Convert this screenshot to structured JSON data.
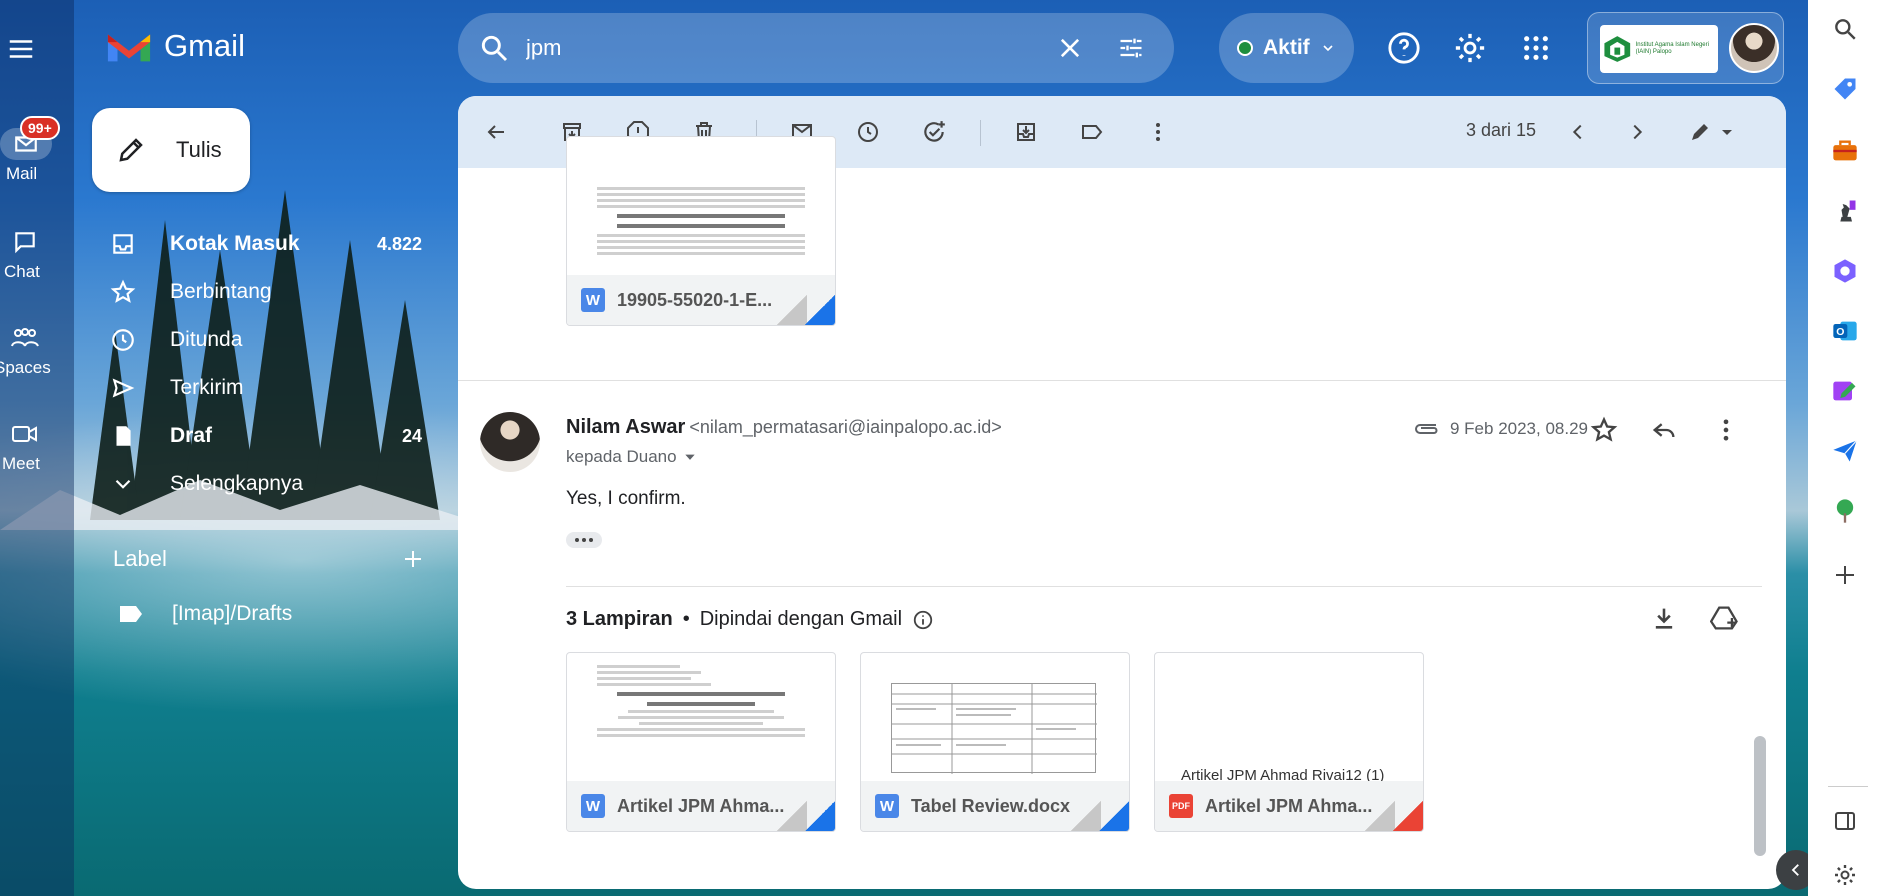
{
  "app": {
    "name": "Gmail"
  },
  "rail": {
    "mail_label": "Mail",
    "mail_badge": "99+",
    "chat_label": "Chat",
    "spaces_label": "Spaces",
    "meet_label": "Meet"
  },
  "compose": {
    "label": "Tulis"
  },
  "nav": {
    "inbox": {
      "label": "Kotak Masuk",
      "count": "4.822"
    },
    "starred": {
      "label": "Berbintang"
    },
    "snoozed": {
      "label": "Ditunda"
    },
    "sent": {
      "label": "Terkirim"
    },
    "drafts": {
      "label": "Draf",
      "count": "24"
    },
    "more": {
      "label": "Selengkapnya"
    }
  },
  "labels": {
    "heading": "Label",
    "items": [
      {
        "label": "[Imap]/Drafts"
      }
    ]
  },
  "search": {
    "value": "jpm"
  },
  "status": {
    "label": "Aktif"
  },
  "org": {
    "text": "Institut Agama Islam Negeri (IAIN) Palopo"
  },
  "toolbar": {
    "pager": "3 dari 15"
  },
  "top_attachment": {
    "filename": "19905-55020-1-E..."
  },
  "message": {
    "sender_name": "Nilam Aswar",
    "sender_email": "<nilam_permatasari@iainpalopo.ac.id>",
    "to": "kepada Duano",
    "date": "9 Feb 2023, 08.29",
    "body": "Yes, I confirm."
  },
  "attachments": {
    "count_label": "3 Lampiran",
    "separator": "•",
    "scan_label": "Dipindai dengan Gmail",
    "items": [
      {
        "filename": "Artikel JPM Ahma...",
        "type": "W"
      },
      {
        "filename": "Tabel Review.docx",
        "type": "W"
      },
      {
        "filename": "Artikel JPM Ahma...",
        "type": "PDF",
        "preview_text": "Artikel JPM Ahmad Rivai12 (1)"
      }
    ]
  },
  "colors": {
    "accent": "#1a73e8",
    "badge": "#d93025",
    "status_green": "#1e8e3e"
  }
}
